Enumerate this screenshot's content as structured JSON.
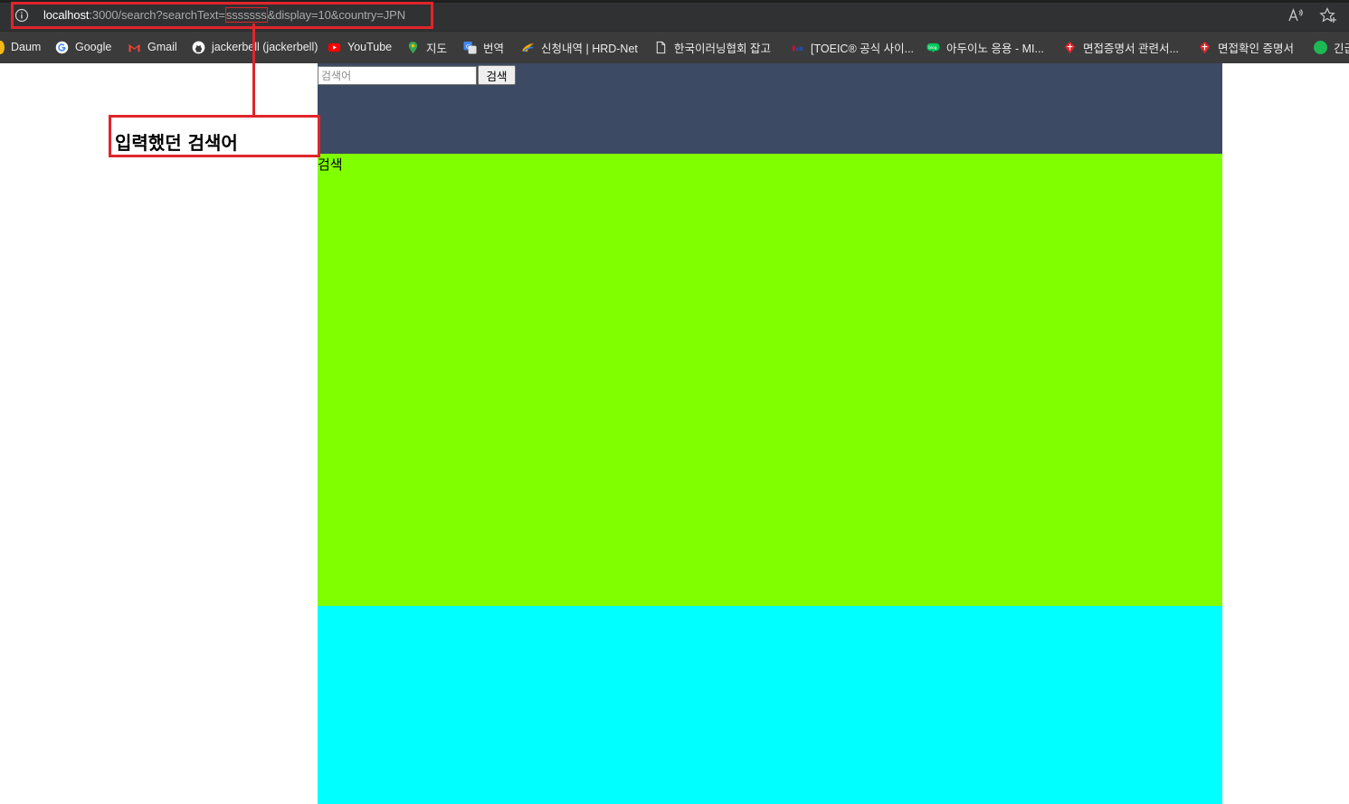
{
  "address_bar": {
    "url_host": "localhost",
    "url_path": ":3000/search?searchText=",
    "url_param_value": "sssssss",
    "url_rest": "&display=10&country=JPN"
  },
  "bookmarks": [
    {
      "label": "Daum",
      "icon": "daum-icon",
      "color": "#f5b914"
    },
    {
      "label": "Google",
      "icon": "google-icon",
      "color": "#ffffff"
    },
    {
      "label": "Gmail",
      "icon": "gmail-icon",
      "color": "#ea4335"
    },
    {
      "label": "jackerbell (jackerbell)",
      "icon": "github-icon",
      "color": "#ffffff"
    },
    {
      "label": "YouTube",
      "icon": "youtube-icon",
      "color": "#ff0000"
    },
    {
      "label": "지도",
      "icon": "maps-pin-icon",
      "color": "#34a853"
    },
    {
      "label": "번역",
      "icon": "translate-icon",
      "color": "#4285f4"
    },
    {
      "label": "신청내역 | HRD-Net",
      "icon": "hrdnet-icon",
      "color": "#f2a900"
    },
    {
      "label": "한국이러닝협회 잡고",
      "icon": "document-icon",
      "color": "#ffffff"
    },
    {
      "label": "[TOEIC® 공식 사이...",
      "icon": "toeic-icon",
      "color": "#c8102e"
    },
    {
      "label": "아두이노 응용 - MI...",
      "icon": "blog-icon",
      "color": "#03c75a"
    },
    {
      "label": "면접증명서 관련서...",
      "icon": "cert-icon",
      "color": "#e0252b"
    },
    {
      "label": "면접확인 증명서",
      "icon": "cert-icon",
      "color": "#e0252b"
    },
    {
      "label": "긴급",
      "icon": "green-circle-icon",
      "color": "#1db954"
    }
  ],
  "annotation": {
    "callout_text": "입력했던 검색어",
    "color": "#e0252b"
  },
  "page": {
    "search_placeholder": "검색어",
    "search_button": "검색",
    "result_label": "검색",
    "colors": {
      "header": "#3d4a63",
      "green": "#80ff00",
      "cyan": "#00ffff"
    }
  }
}
